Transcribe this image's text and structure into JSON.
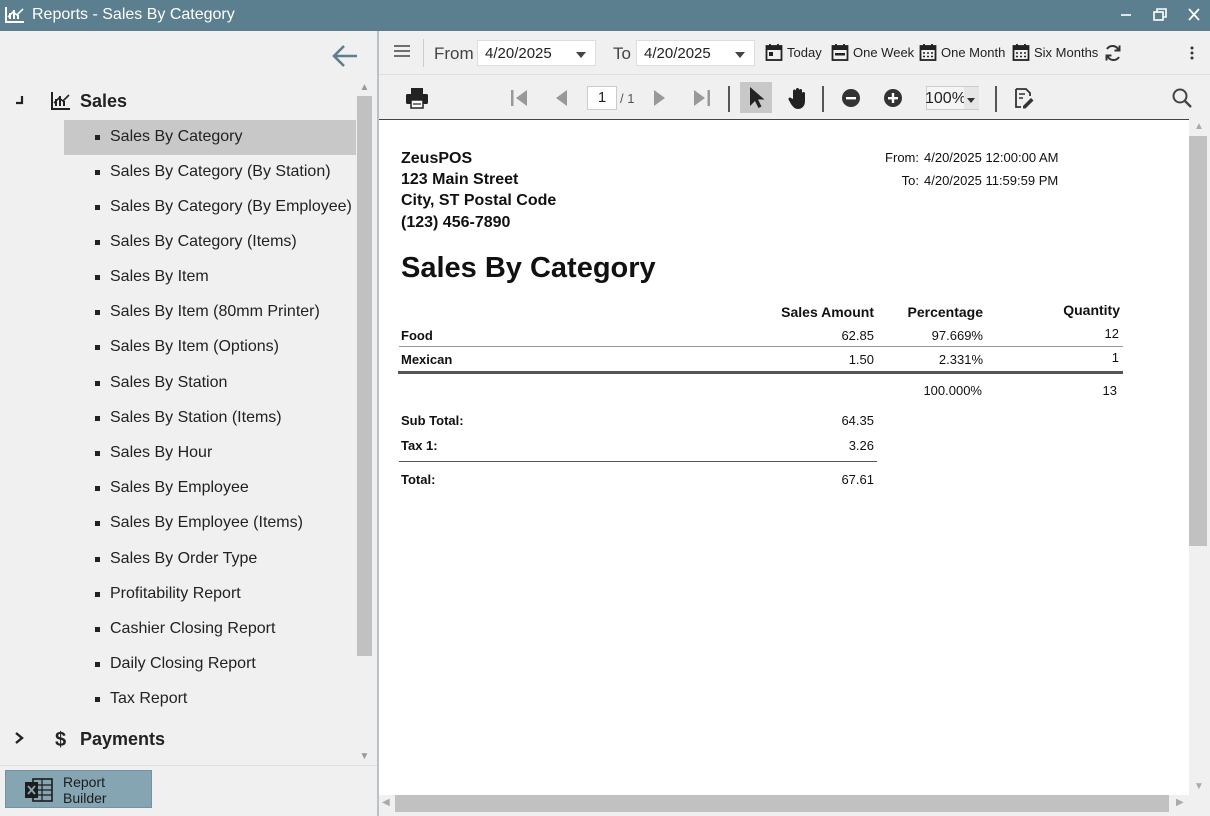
{
  "window": {
    "title": "Reports - Sales By Category"
  },
  "sidebar": {
    "groups": [
      {
        "label": "Sales",
        "expanded": true
      },
      {
        "label": "Payments",
        "expanded": false
      }
    ],
    "items": [
      "Sales By Category",
      "Sales By Category (By Station)",
      "Sales By Category (By Employee)",
      "Sales By Category (Items)",
      "Sales By Item",
      "Sales By Item (80mm Printer)",
      "Sales By Item (Options)",
      "Sales By Station",
      "Sales By Station (Items)",
      "Sales By Hour",
      "Sales By Employee",
      "Sales By Employee (Items)",
      "Sales By Order Type",
      "Profitability Report",
      "Cashier Closing Report",
      "Daily Closing Report",
      "Tax Report"
    ],
    "selected_item": "Sales By Category",
    "report_builder_line1": "Report",
    "report_builder_line2": "Builder"
  },
  "toolbar": {
    "from_label": "From",
    "from_value": "4/20/2025",
    "to_label": "To",
    "to_value": "4/20/2025",
    "quick_ranges": [
      "Today",
      "One Week",
      "One Month",
      "Six Months"
    ]
  },
  "viewer": {
    "page_current": "1",
    "page_total": "/ 1",
    "zoom": "100%"
  },
  "report": {
    "company": "ZeusPOS",
    "address1": "123 Main Street",
    "address2": "City, ST Postal Code",
    "phone": "(123) 456-7890",
    "from_label": "From:",
    "from_value": "4/20/2025 12:00:00 AM",
    "to_label": "To:",
    "to_value": "4/20/2025 11:59:59 PM",
    "title": "Sales By Category",
    "columns": [
      "Sales Amount",
      "Percentage",
      "Quantity"
    ],
    "rows": [
      {
        "category": "Food",
        "sales_amount": "62.85",
        "percentage": "97.669%",
        "quantity": "12"
      },
      {
        "category": "Mexican",
        "sales_amount": "1.50",
        "percentage": "2.331%",
        "quantity": "1"
      }
    ],
    "totals_percentage": "100.000%",
    "totals_quantity": "13",
    "subtotal_label": "Sub Total:",
    "subtotal_value": "64.35",
    "tax_label": "Tax 1:",
    "tax_value": "3.26",
    "total_label": "Total:",
    "total_value": "67.61"
  },
  "colors": {
    "titlebar": "#5b7f8f",
    "selected_item": "#c8c8c8",
    "report_builder": "#86a5b3"
  }
}
